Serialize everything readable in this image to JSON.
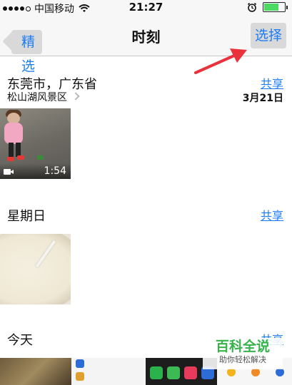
{
  "status_bar": {
    "carrier": "中国移动",
    "time": "21:27",
    "battery_level": 0.7,
    "signal_bars": 4,
    "icons": [
      "wifi-icon",
      "alarm-icon",
      "battery-icon"
    ]
  },
  "nav": {
    "back_label": "精选",
    "title": "时刻",
    "select_label": "选择"
  },
  "moments": [
    {
      "title": "东莞市，广东省",
      "subtitle": "松山湖风景区",
      "date": "3月21日",
      "share_label": "共享",
      "items": [
        {
          "type": "video",
          "duration": "1:54"
        }
      ]
    },
    {
      "title": "星期日",
      "share_label": "共享",
      "items": [
        {
          "type": "photo"
        }
      ]
    },
    {
      "title": "今天",
      "share_label": "共享"
    }
  ],
  "watermark": {
    "main": "百科全说",
    "sub": "助你轻松解决"
  },
  "colors": {
    "accent": "#1a7cf5",
    "arrow": "#e8323c",
    "watermark": "#35b34a"
  }
}
